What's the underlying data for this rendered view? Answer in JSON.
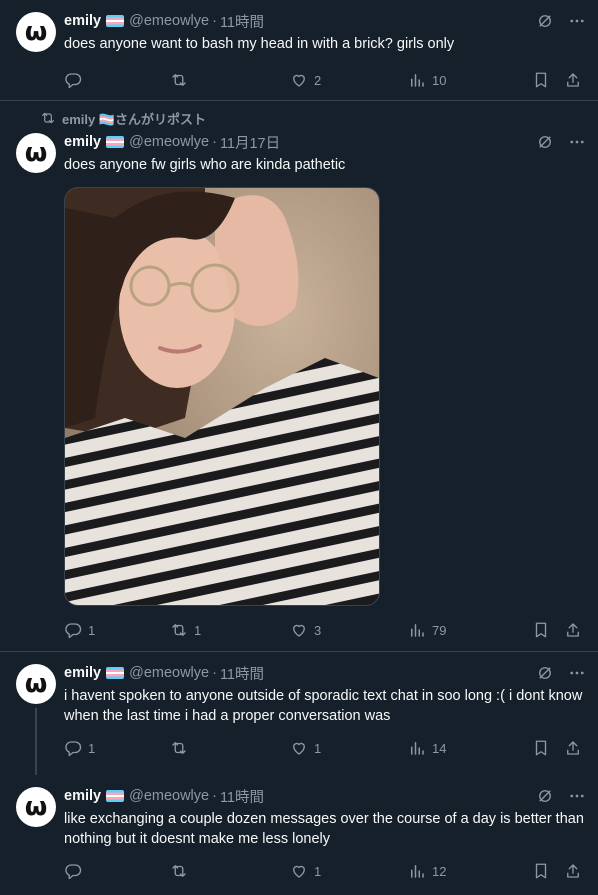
{
  "tweets": [
    {
      "name": "emily",
      "handle": "@emeowlye",
      "time": "11時間",
      "text": "does anyone want to bash my head in with a brick? girls only",
      "replies": "",
      "reposts": "",
      "likes": "2",
      "views": "10"
    },
    {
      "repost_label": "emily 🏳️‍⚧️さんがリポスト",
      "name": "emily",
      "handle": "@emeowlye",
      "time": "11月17日",
      "text": "does anyone fw girls who are kinda pathetic",
      "replies": "1",
      "reposts": "1",
      "likes": "3",
      "views": "79"
    },
    {
      "name": "emily",
      "handle": "@emeowlye",
      "time": "11時間",
      "text": "i havent spoken to anyone outside of sporadic text chat in soo long :( i dont know when the last time i had a proper conversation was",
      "replies": "1",
      "reposts": "",
      "likes": "1",
      "views": "14"
    },
    {
      "name": "emily",
      "handle": "@emeowlye",
      "time": "11時間",
      "text": "like exchanging a couple dozen messages over the course of a day is better than nothing but it doesnt make me less lonely",
      "replies": "",
      "reposts": "",
      "likes": "1",
      "views": "12"
    }
  ],
  "avatar_glyph": "ω",
  "colors": {
    "background": "#15202b",
    "border": "#38444d",
    "muted": "#8b98a5",
    "text": "#f7f9f9"
  }
}
